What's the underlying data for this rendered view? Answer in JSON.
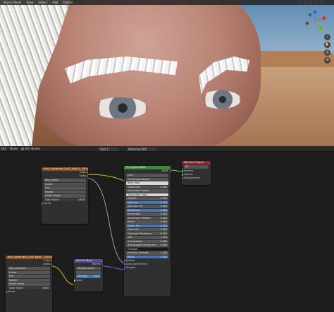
{
  "topbar": {
    "mode": "Object Mode",
    "menus": [
      "View",
      "Select",
      "Add",
      "Object"
    ]
  },
  "viewport_info": [
    "User Perspective",
    "(1) Collection | ...",
    "Scene Collection"
  ],
  "gizmo": {
    "x": "X",
    "y": "Y",
    "z": "Z"
  },
  "node_header": {
    "menus": [
      "Add",
      "Node"
    ],
    "use_nodes": "Use Nodes",
    "slot": "Slot 1",
    "material": "Material.005"
  },
  "nodes": {
    "image1": {
      "title": "eyes_eyebrows_Lv05_base_r...00.png",
      "outputs": [
        "Color",
        "Alpha"
      ],
      "image_name": "eley_eyebr...",
      "options": [
        "Linear",
        "Flat",
        "Repeat",
        "Single Image"
      ],
      "color_space_label": "Color Space",
      "color_space": "sRGB",
      "vector": "Vector"
    },
    "image2": {
      "title": "eley_eyebrows_Lv05_base_...006.png",
      "outputs": [
        "Color",
        "Alpha"
      ],
      "image_name": "eley_eyebrow...",
      "options": [
        "Linear",
        "Flat",
        "Repeat",
        "Single Image"
      ],
      "color_space_label": "Color Space",
      "color_space": "sRGB",
      "vector": "Vector"
    },
    "normal_map": {
      "title": "Normal Map",
      "output": "Normal",
      "space": "Tangent Space",
      "uv": "",
      "strength_label": "Strength",
      "strength": "1.000",
      "color": "Color"
    },
    "bsdf": {
      "title": "Principled BSDF",
      "output": "BSDF",
      "ggx": "GGX",
      "sss": "Christensen-Burley",
      "rows": [
        {
          "label": "Base Color",
          "value": "",
          "kind": "white"
        },
        {
          "label": "Subsurface",
          "value": "0.000",
          "kind": "grey"
        },
        {
          "label": "Subsurface Radius",
          "value": "",
          "kind": "grey"
        },
        {
          "label": "Subsurface Color",
          "value": "",
          "kind": "white"
        },
        {
          "label": "Metallic",
          "value": "0.000",
          "kind": "grey"
        },
        {
          "label": "Specular",
          "value": "0.500",
          "kind": "blue"
        },
        {
          "label": "Specular Tint",
          "value": "0.000",
          "kind": "grey"
        },
        {
          "label": "Roughness",
          "value": "0.500",
          "kind": "blue"
        },
        {
          "label": "Anisotropic",
          "value": "0.000",
          "kind": "grey"
        },
        {
          "label": "Anisotropic Rotation",
          "value": "0.000",
          "kind": "grey"
        },
        {
          "label": "Sheen",
          "value": "0.000",
          "kind": "grey"
        },
        {
          "label": "Sheen Tint",
          "value": "0.500",
          "kind": "blue"
        },
        {
          "label": "Clearcoat",
          "value": "0.000",
          "kind": "grey"
        },
        {
          "label": "Clearcoat Roughness",
          "value": "0.030",
          "kind": "grey"
        },
        {
          "label": "IOR",
          "value": "1.450",
          "kind": "grey"
        },
        {
          "label": "Transmission",
          "value": "0.000",
          "kind": "grey"
        },
        {
          "label": "Transmission Roughness",
          "value": "0.000",
          "kind": "grey"
        },
        {
          "label": "Emission",
          "value": "",
          "kind": "dark"
        },
        {
          "label": "Emission Strength",
          "value": "1.000",
          "kind": "grey"
        },
        {
          "label": "Alpha",
          "value": "1.000",
          "kind": "blue"
        }
      ],
      "inputs": [
        "Normal",
        "Clearcoat Normal",
        "Tangent"
      ]
    },
    "output": {
      "title": "Material Output",
      "target": "All",
      "inputs": [
        "Surface",
        "Volume",
        "Displacement"
      ]
    }
  },
  "colors": {
    "texture_header": "#8a4f1e",
    "shader_header": "#3c8a3b",
    "vector_header": "#5a4a9c",
    "output_header": "#8c2b32",
    "socket_color": "#c7c729",
    "socket_shader": "#62d162",
    "socket_vector": "#6363c7",
    "socket_grey": "#a1a1a1",
    "socket_alpha": "#a1a1a1"
  }
}
